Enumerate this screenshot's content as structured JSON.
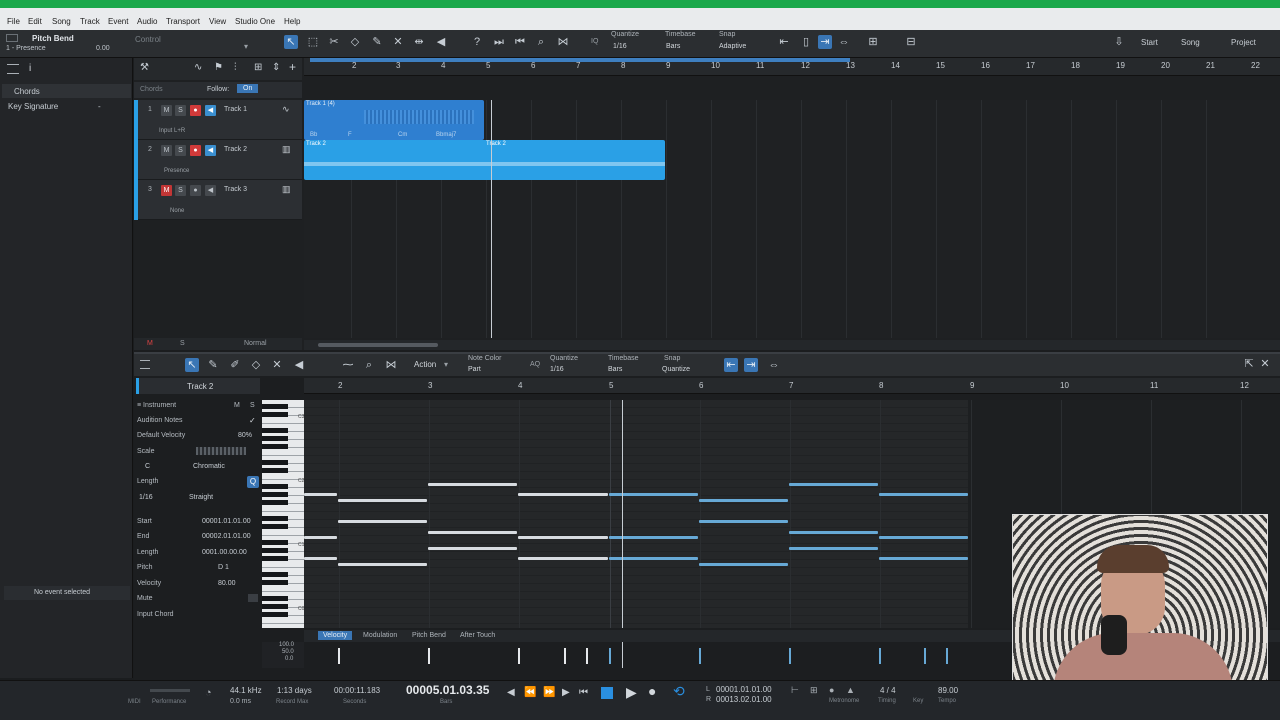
{
  "menu": [
    "File",
    "Edit",
    "Song",
    "Track",
    "Event",
    "Audio",
    "Transport",
    "View",
    "Studio One",
    "Help"
  ],
  "control": {
    "title": "Pitch Bend",
    "device": "1 - Presence",
    "value": "0.00",
    "control_label": "Control",
    "quantize_label": "Quantize",
    "quantize_value": "1/16",
    "timebase_label": "Timebase",
    "timebase_value": "Bars",
    "snap_label": "Snap",
    "snap_value": "Adaptive",
    "iq": "IQ",
    "start": "Start",
    "song": "Song",
    "project": "Project"
  },
  "inspector": {
    "chords": "Chords",
    "key_signature": "Key Signature",
    "dash": "-",
    "no_event": "No event selected"
  },
  "arrange": {
    "chords_label": "Chords",
    "follow_label": "Follow:",
    "follow_value": "On",
    "ruler": [
      "2",
      "3",
      "4",
      "5",
      "6",
      "7",
      "8",
      "9",
      "10",
      "11",
      "12",
      "13",
      "14",
      "15",
      "16",
      "17",
      "18",
      "19",
      "20",
      "21",
      "22"
    ],
    "tracks": [
      {
        "num": "1",
        "name": "Track 1",
        "sub": "Input L+R"
      },
      {
        "num": "2",
        "name": "Track 2",
        "sub": "Presence"
      },
      {
        "num": "3",
        "name": "Track 3",
        "sub": "None"
      }
    ],
    "clips": {
      "track1": "Track 1 (4)",
      "track2a": "Track 2",
      "track2b": "Track 2",
      "chord_1": "Bb",
      "chord_2": "F",
      "chord_3": "Cm",
      "chord_4": "Bbmaj7"
    },
    "bottom_m": "M",
    "bottom_s": "S",
    "bottom_normal": "Normal",
    "m": "M",
    "s": "S"
  },
  "piano": {
    "action": "Action",
    "note_color_label": "Note Color",
    "note_color_value": "Part",
    "aq": "AQ",
    "quantize_label": "Quantize",
    "quantize_value": "1/16",
    "timebase_label": "Timebase",
    "timebase_value": "Bars",
    "snap_label": "Snap",
    "snap_value": "Quantize",
    "track_name": "Track 2",
    "instrument": "Instrument",
    "audition_notes": "Audition Notes",
    "default_velocity": "Default Velocity",
    "default_velocity_value": "80%",
    "scale": "Scale",
    "scale_root": "C",
    "scale_type": "Chromatic",
    "length_label": "Length",
    "length_value": "1/16",
    "length_mode": "Straight",
    "start_label": "Start",
    "start_value": "00001.01.01.00",
    "end_label": "End",
    "end_value": "00002.01.01.00",
    "len_label": "Length",
    "len_value": "0001.00.00.00",
    "pitch_label": "Pitch",
    "pitch_value": "D 1",
    "velocity_label": "Velocity",
    "velocity_value": "80.00",
    "mute_label": "Mute",
    "input_chord": "Input Chord",
    "ruler": [
      "2",
      "3",
      "4",
      "5",
      "6",
      "7",
      "8",
      "9",
      "10",
      "11",
      "12"
    ],
    "tabs": [
      "Velocity",
      "Modulation",
      "Pitch Bend",
      "After Touch"
    ],
    "vel_scale": [
      "100.0",
      "50.0",
      "0.0"
    ],
    "key_c3": "C3",
    "key_c2": "C2",
    "key_c1": "C1",
    "key_c0": "C0"
  },
  "transport": {
    "midi": "MIDI",
    "performance": "Performance",
    "sample_rate": "44.1 kHz",
    "latency": "0.0 ms",
    "record_time": "1:13 days",
    "record_max": "Record Max",
    "seconds_value": "00:00:11.183",
    "seconds_label": "Seconds",
    "bars_value": "00005.01.03.35",
    "bars_label": "Bars",
    "loop_start": "00001.01.01.00",
    "loop_end": "00013.02.01.00",
    "metronome": "Metronome",
    "timing_value": "4 / 4",
    "timing_label": "Timing",
    "key_label": "Key",
    "tempo_value": "89.00",
    "tempo_label": "Tempo",
    "l": "L",
    "r": "R"
  }
}
